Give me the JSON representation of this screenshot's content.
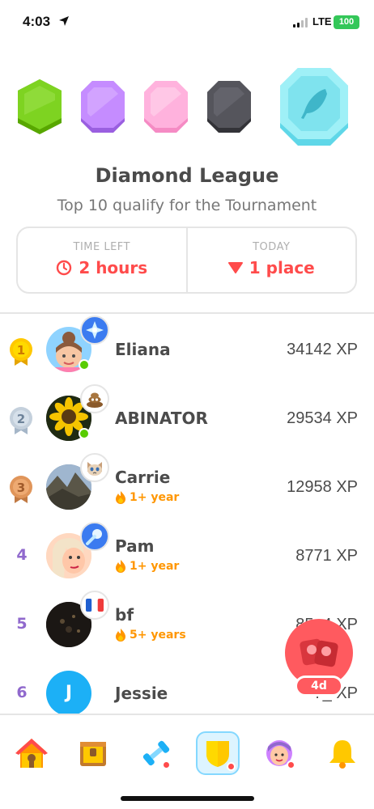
{
  "status_bar": {
    "time": "4:03",
    "network": "LTE",
    "battery": "100"
  },
  "league": {
    "title": "Diamond League",
    "subtitle": "Top 10 qualify for the Tournament",
    "badges": [
      "green-league-badge",
      "purple-league-badge",
      "pink-league-badge",
      "black-league-badge",
      "diamond-league-badge"
    ]
  },
  "info": {
    "time_left_label": "TIME LEFT",
    "time_left_value": "2 hours",
    "today_label": "TODAY",
    "today_value": "1 place"
  },
  "leaderboard": [
    {
      "rank": "1",
      "name": "Eliana",
      "xp": "34142 XP",
      "streak": "",
      "online": true
    },
    {
      "rank": "2",
      "name": "ABINATOR",
      "xp": "29534 XP",
      "streak": "",
      "online": true
    },
    {
      "rank": "3",
      "name": "Carrie",
      "xp": "12958 XP",
      "streak": "1+ year",
      "online": false
    },
    {
      "rank": "4",
      "name": "Pam",
      "xp": "8771 XP",
      "streak": "1+ year",
      "online": false
    },
    {
      "rank": "5",
      "name": "bf",
      "xp": "85_4 XP",
      "streak": "5+ years",
      "online": false
    },
    {
      "rank": "6",
      "name": "Jessie",
      "xp": "7_ XP",
      "streak": "",
      "online": false,
      "initial": "J"
    }
  ],
  "promo": {
    "label": "4d"
  },
  "colors": {
    "accent_red": "#ff4b4b",
    "streak_orange": "#ff9600",
    "rank_purple": "#9069cd",
    "online_green": "#58cc02",
    "promo_red": "#ff5a5f"
  },
  "nav": [
    "home-icon",
    "treasure-chest-icon",
    "practice-dumbbell-icon",
    "leaderboard-shield-icon",
    "profile-icon",
    "notifications-bell-icon"
  ]
}
